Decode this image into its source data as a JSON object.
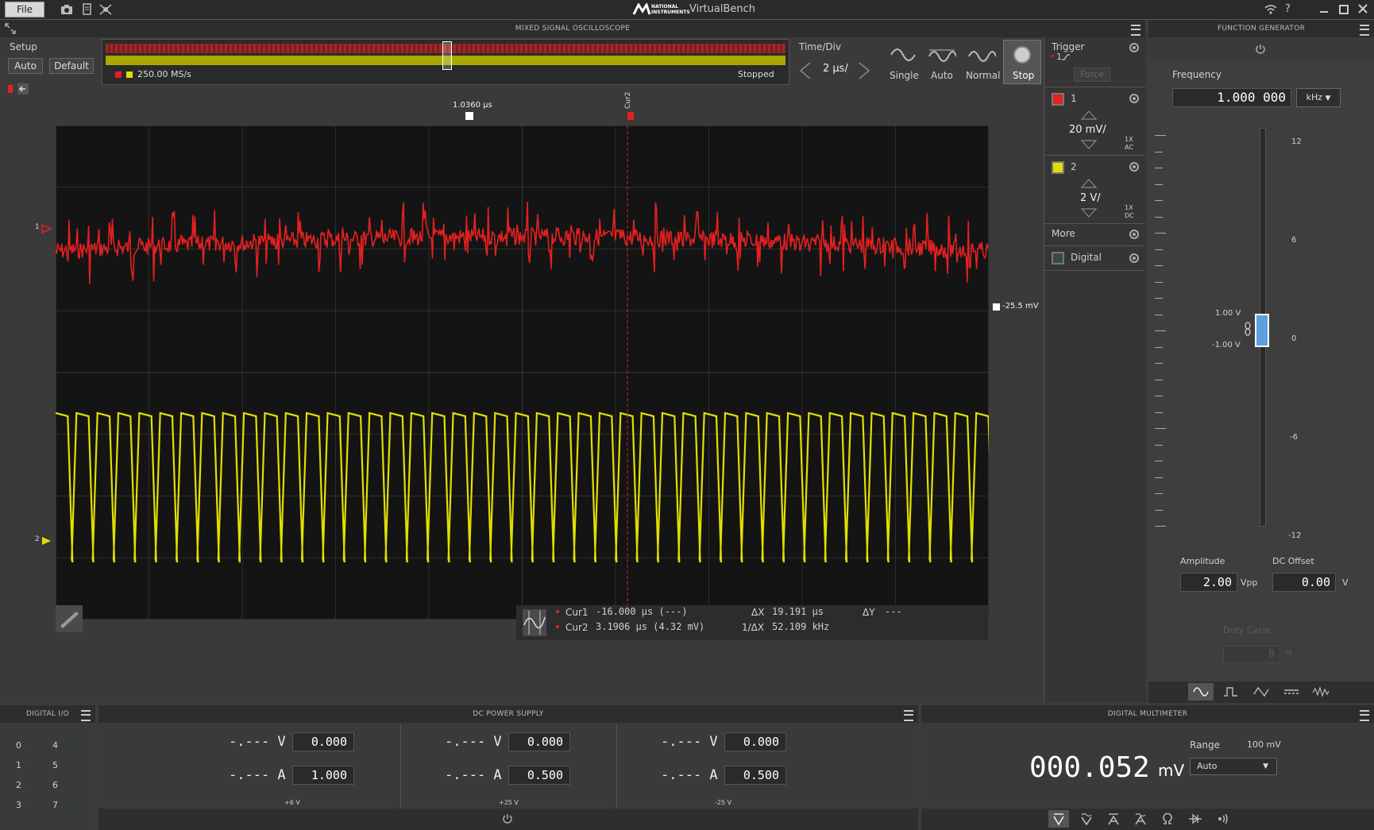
{
  "titlebar": {
    "file": "File",
    "logo_text": "NATIONAL INSTRUMENTS",
    "app": "VirtualBench",
    "help": "?"
  },
  "scope": {
    "title": "MIXED SIGNAL OSCILLOSCOPE",
    "setup": "Setup",
    "auto": "Auto",
    "default": "Default",
    "sample_rate": "250.00 MS/s",
    "status": "Stopped",
    "timediv_label": "Time/Div",
    "timediv": "2 µs/",
    "modes": [
      "Single",
      "Auto",
      "Normal",
      "Stop"
    ],
    "trig_pos_label": "1.0360 µs",
    "cur2_label": "Cur2",
    "trig_level": "-25.5 mV",
    "ch1_marker": "1",
    "ch2_marker": "2",
    "trigger": {
      "title": "Trigger",
      "source": "1",
      "force": "Force"
    },
    "ch1": {
      "num": "1",
      "scale": "20 mV/",
      "probe": "1X",
      "coupling": "AC",
      "color": "#e52020"
    },
    "ch2": {
      "num": "2",
      "scale": "2 V/",
      "probe": "1X",
      "coupling": "DC",
      "color": "#e0e000"
    },
    "more": "More",
    "digital": "Digital",
    "cursors": {
      "cur1_name": "Cur1",
      "cur1_val": "-16.000 µs (---)",
      "cur2_name": "Cur2",
      "cur2_val": "3.1906 µs (4.32 mV)",
      "dx_label": "ΔX",
      "dx": "19.191 µs",
      "invdx_label": "1/ΔX",
      "invdx": "52.109 kHz",
      "dy_label": "ΔY",
      "dy": "---"
    }
  },
  "fgen": {
    "title": "FUNCTION GENERATOR",
    "freq_label": "Frequency",
    "freq": "1.000 000",
    "unit": "kHz",
    "scale": [
      "12",
      "6",
      "0",
      "-6",
      "-12"
    ],
    "high": "1.00 V",
    "low": "-1.00 V",
    "amp_label": "Amplitude",
    "amp": "2.00",
    "amp_unit": "Vpp",
    "offset_label": "DC Offset",
    "offset": "0.00",
    "offset_unit": "V",
    "duty_label": "Duty Cycle",
    "duty": "0",
    "duty_unit": "%"
  },
  "dio": {
    "title": "DIGITAL I/O",
    "pins": [
      "0",
      "4",
      "1",
      "5",
      "2",
      "6",
      "3",
      "7"
    ]
  },
  "dcps": {
    "title": "DC POWER SUPPLY",
    "channels": [
      {
        "meas_v": "-.--- V",
        "set_v": "0.000",
        "meas_a": "-.--- A",
        "set_a": "1.000",
        "name": "+6 V"
      },
      {
        "meas_v": "-.--- V",
        "set_v": "0.000",
        "meas_a": "-.--- A",
        "set_a": "0.500",
        "name": "+25 V"
      },
      {
        "meas_v": "-.--- V",
        "set_v": "0.000",
        "meas_a": "-.--- A",
        "set_a": "0.500",
        "name": "-25 V"
      }
    ]
  },
  "dmm": {
    "title": "DIGITAL MULTIMETER",
    "value": "000.052",
    "unit": "mV",
    "range_label": "Range",
    "range_val": "100 mV",
    "range_sel": "Auto"
  }
}
